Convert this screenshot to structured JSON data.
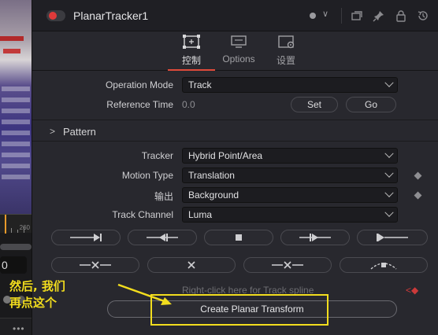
{
  "window": {
    "title": "PlanarTracker1"
  },
  "viewer": {
    "frame_label": "260",
    "frame_value": "0"
  },
  "tabs": [
    {
      "label": "控制",
      "icon": "controls-icon",
      "active": true
    },
    {
      "label": "Options",
      "icon": "options-icon",
      "active": false
    },
    {
      "label": "设置",
      "icon": "settings-icon",
      "active": false
    }
  ],
  "controls": {
    "operation_mode": {
      "label": "Operation Mode",
      "value": "Track"
    },
    "reference_time": {
      "label": "Reference Time",
      "value": "0.0",
      "set_label": "Set",
      "go_label": "Go"
    },
    "pattern_section": {
      "label": "Pattern"
    },
    "tracker": {
      "label": "Tracker",
      "value": "Hybrid Point/Area"
    },
    "motion_type": {
      "label": "Motion Type",
      "value": "Translation"
    },
    "output": {
      "label": "输出",
      "value": "Background"
    },
    "track_channel": {
      "label": "Track Channel",
      "value": "Luma"
    }
  },
  "track_buttons_row1": [
    {
      "icon": "track-to-start-icon"
    },
    {
      "icon": "track-backward-icon"
    },
    {
      "icon": "stop-tracking-icon"
    },
    {
      "icon": "track-forward-icon"
    },
    {
      "icon": "track-to-end-icon"
    }
  ],
  "track_buttons_row2": [
    {
      "icon": "delete-track-before-icon"
    },
    {
      "icon": "delete-track-icon"
    },
    {
      "icon": "delete-track-after-icon"
    },
    {
      "icon": "track-spline-icon"
    }
  ],
  "hint": {
    "text": "Right-click here for Track spline"
  },
  "create_button": {
    "label": "Create Planar Transform"
  },
  "annotation": {
    "line1": "然后, 我们",
    "line2": "再点这个"
  },
  "colors": {
    "accent": "#e04a3a",
    "highlight": "#f2dd1e",
    "record": "#e03a3a"
  }
}
